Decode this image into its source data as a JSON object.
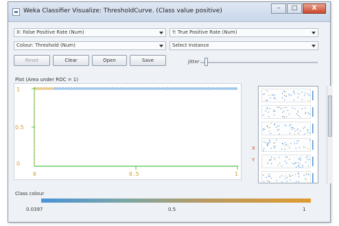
{
  "window": {
    "title": "Weka Classifier Visualize: ThresholdCurve. (Class value positive)",
    "controls": {
      "minimize": "–",
      "maximize": "□",
      "close": "X"
    }
  },
  "selectors": {
    "x_axis": "X: False Positive Rate (Num)",
    "y_axis": "Y: True Positive Rate (Num)",
    "colour": "Colour: Threshold (Num)",
    "instance": "Select Instance"
  },
  "buttons": {
    "reset": "Reset",
    "clear": "Clear",
    "open": "Open",
    "save": "Save"
  },
  "jitter": {
    "label": "Jitter",
    "value": 0
  },
  "plot": {
    "label": "Plot (Area under ROC = 1)",
    "y_ticks": [
      "1",
      "0.5",
      "0"
    ],
    "x_ticks": [
      "0",
      "0.5",
      "1"
    ],
    "colors": {
      "points_top": "#4a93d8",
      "axis": "#52c152",
      "tick_labels": "#d59a2a"
    }
  },
  "side_markers": [
    "X",
    "Y"
  ],
  "class_colour": {
    "label": "Class colour",
    "ticks": [
      "0.0397",
      "0.5",
      "1"
    ]
  }
}
